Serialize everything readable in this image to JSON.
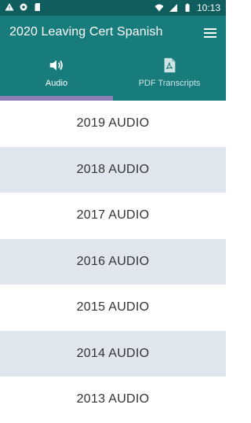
{
  "statusbar": {
    "time": "10:13"
  },
  "appbar": {
    "title": "2020 Leaving Cert Spanish"
  },
  "tabs": [
    {
      "label": "Audio",
      "icon": "volume-icon"
    },
    {
      "label": "PDF Transcripts",
      "icon": "pdf-icon"
    }
  ],
  "audio_list": [
    "2019 AUDIO",
    "2018 AUDIO",
    "2017 AUDIO",
    "2016 AUDIO",
    "2015 AUDIO",
    "2014 AUDIO",
    "2013 AUDIO"
  ],
  "colors": {
    "appbar": "#177c7b",
    "statusbar": "#0f5e5d",
    "indicator": "#8b7fb6",
    "alt_row": "#dfe6ee"
  }
}
